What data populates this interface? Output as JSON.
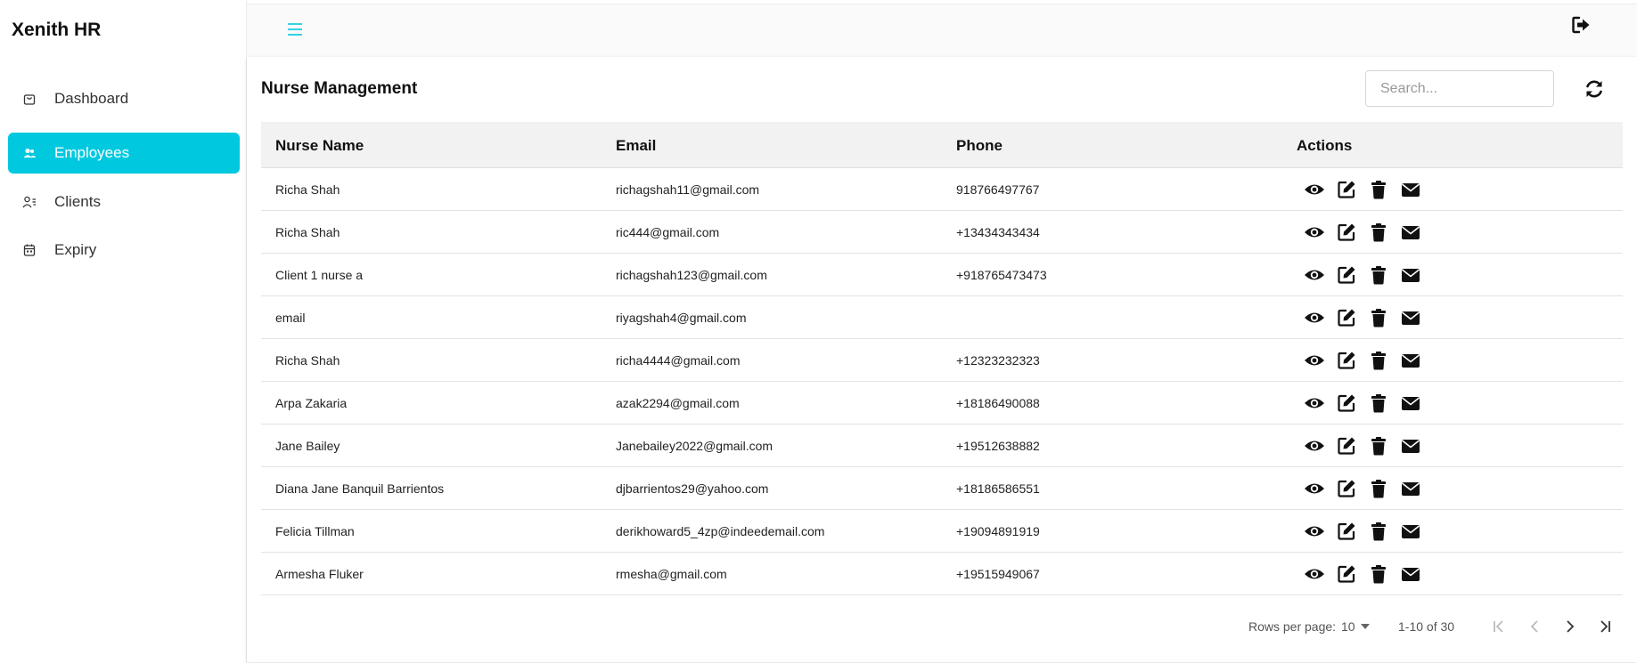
{
  "app": {
    "brand": "Xenith HR"
  },
  "sidebar": {
    "items": [
      {
        "label": "Dashboard",
        "icon": "bag-icon",
        "active": false
      },
      {
        "label": "Employees",
        "icon": "users-icon",
        "active": true
      },
      {
        "label": "Clients",
        "icon": "user-list-icon",
        "active": false
      },
      {
        "label": "Expiry",
        "icon": "calendar-icon",
        "active": false
      }
    ]
  },
  "topbar": {
    "menu_icon": "hamburger-icon",
    "logout_icon": "logout-icon"
  },
  "main": {
    "title": "Nurse Management",
    "search": {
      "placeholder": "Search...",
      "value": ""
    },
    "refresh_icon": "refresh-icon"
  },
  "table": {
    "headers": [
      "Nurse Name",
      "Email",
      "Phone",
      "Actions"
    ],
    "rows": [
      {
        "name": "Richa Shah",
        "email": "richagshah11@gmail.com",
        "phone": "918766497767"
      },
      {
        "name": "Richa Shah",
        "email": "ric444@gmail.com",
        "phone": "+13434343434"
      },
      {
        "name": "Client 1 nurse a",
        "email": "richagshah123@gmail.com",
        "phone": "+918765473473"
      },
      {
        "name": "email",
        "email": "riyagshah4@gmail.com",
        "phone": ""
      },
      {
        "name": "Richa Shah",
        "email": "richa4444@gmail.com",
        "phone": "+12323232323"
      },
      {
        "name": "Arpa Zakaria",
        "email": "azak2294@gmail.com",
        "phone": "+18186490088"
      },
      {
        "name": "Jane Bailey",
        "email": "Janebailey2022@gmail.com",
        "phone": "+19512638882"
      },
      {
        "name": "Diana Jane Banquil Barrientos",
        "email": "djbarrientos29@yahoo.com",
        "phone": "+18186586551"
      },
      {
        "name": "Felicia Tillman",
        "email": "derikhoward5_4zp@indeedemail.com",
        "phone": "+19094891919"
      },
      {
        "name": "Armesha Fluker",
        "email": "rmesha@gmail.com",
        "phone": "+19515949067"
      }
    ],
    "action_icons": [
      "eye-icon",
      "edit-icon",
      "trash-icon",
      "mail-icon"
    ]
  },
  "pagination": {
    "rows_per_page_label": "Rows per page:",
    "rows_per_page_value": "10",
    "range_label": "1-10 of 30"
  },
  "colors": {
    "accent": "#00c9df",
    "text": "#222222"
  }
}
